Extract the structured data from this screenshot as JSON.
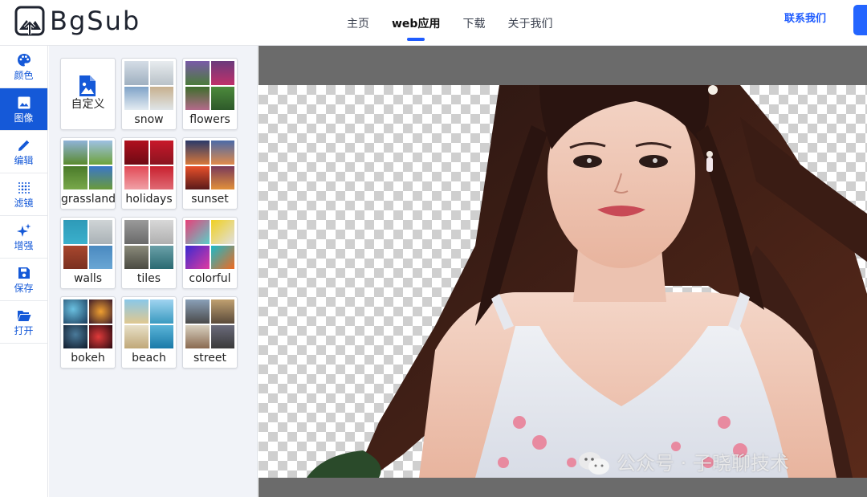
{
  "brand": {
    "name": "BgSub"
  },
  "nav": {
    "items": [
      {
        "label": "主页",
        "active": false
      },
      {
        "label": "web应用",
        "active": true
      },
      {
        "label": "下载",
        "active": false
      },
      {
        "label": "关于我们",
        "active": false
      }
    ],
    "contact_label": "联系我们"
  },
  "rail": {
    "items": [
      {
        "label": "颜色",
        "icon": "palette-icon"
      },
      {
        "label": "图像",
        "icon": "image-icon",
        "active": true
      },
      {
        "label": "编辑",
        "icon": "pencil-icon"
      },
      {
        "label": "滤镜",
        "icon": "dots-grid-icon"
      },
      {
        "label": "增强",
        "icon": "sparkles-icon"
      },
      {
        "label": "保存",
        "icon": "floppy-icon"
      },
      {
        "label": "打开",
        "icon": "folder-open-icon"
      }
    ]
  },
  "backgrounds": {
    "custom_label": "自定义",
    "tiles": [
      {
        "label": "snow"
      },
      {
        "label": "flowers"
      },
      {
        "label": "grassland"
      },
      {
        "label": "holidays"
      },
      {
        "label": "sunset"
      },
      {
        "label": "walls"
      },
      {
        "label": "tiles"
      },
      {
        "label": "colorful"
      },
      {
        "label": "bokeh"
      },
      {
        "label": "beach"
      },
      {
        "label": "street"
      }
    ]
  },
  "watermark": {
    "text": "公众号 · 子晓聊技术"
  },
  "colors": {
    "accent": "#1559d8",
    "nav_underline": "#1f5cff",
    "canvas_bg": "#6b6b6b"
  }
}
